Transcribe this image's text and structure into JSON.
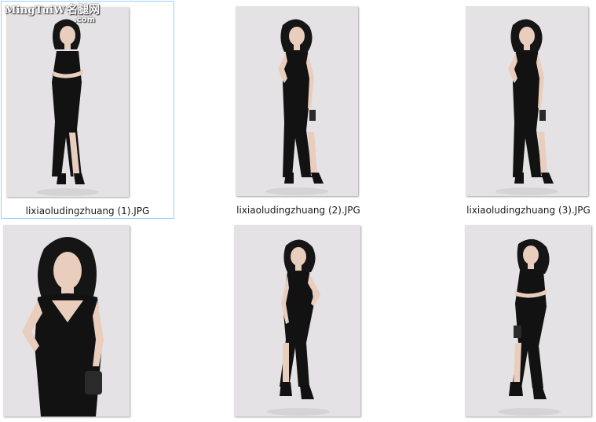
{
  "watermark": {
    "brand": "MingTuiW",
    "chinese": "名腿网",
    "domain": ".com"
  },
  "files": [
    {
      "name": "lixiaoludingzhuang (1).JPG",
      "selected": true,
      "pose": "arms-crossed"
    },
    {
      "name": "lixiaoludingzhuang (2).JPG",
      "selected": false,
      "pose": "hand-on-hip"
    },
    {
      "name": "lixiaoludingzhuang (3).JPG",
      "selected": false,
      "pose": "hand-on-hip"
    },
    {
      "name": "",
      "selected": false,
      "pose": "close-up"
    },
    {
      "name": "",
      "selected": false,
      "pose": "side-pose"
    },
    {
      "name": "",
      "selected": false,
      "pose": "side-arms-crossed"
    }
  ],
  "colors": {
    "background": "#ffffff",
    "photo_backdrop": "#e4e2e4",
    "dress": "#121212",
    "skin": "#e9cdbd",
    "hair": "#151515",
    "selection_border": "#99d1ff"
  }
}
